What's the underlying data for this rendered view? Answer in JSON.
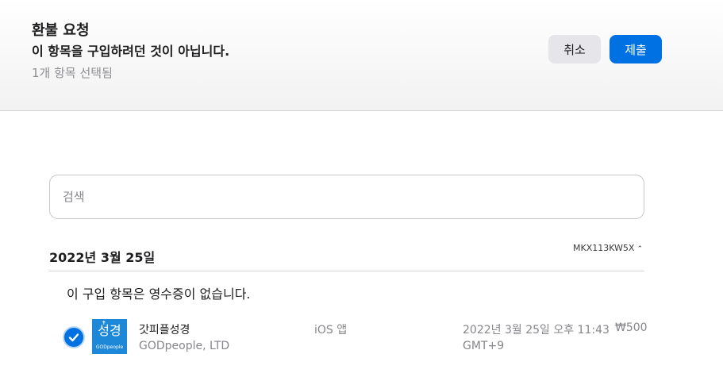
{
  "header": {
    "title": "환불 요청",
    "reason": "이 항목을 구입하려던 것이 아닙니다.",
    "selected_count": "1개 항목 선택됨",
    "cancel_label": "취소",
    "submit_label": "제출"
  },
  "search": {
    "placeholder": "검색",
    "value": ""
  },
  "order": {
    "date": "2022년 3월 25일",
    "id": "MKX113KW5X",
    "expand_icon": "chevron-up-icon",
    "receipt_note": "이 구입 항목은 영수증이 없습니다."
  },
  "item": {
    "checked": true,
    "icon": {
      "main_text": "성경",
      "brand_text": "GODpeople"
    },
    "name": "갓피플성경",
    "developer": "GODpeople, LTD",
    "type": "iOS 앱",
    "purchase_date": "2022년 3월 25일 오후 11:43",
    "timezone": "GMT+9",
    "price": "₩500"
  },
  "colors": {
    "accent": "#0071e3",
    "header_bg": "#f2f2f2",
    "secondary_text": "#86868b",
    "cancel_bg": "#e5e5ea",
    "app_icon_bg": "#1e88d8"
  }
}
